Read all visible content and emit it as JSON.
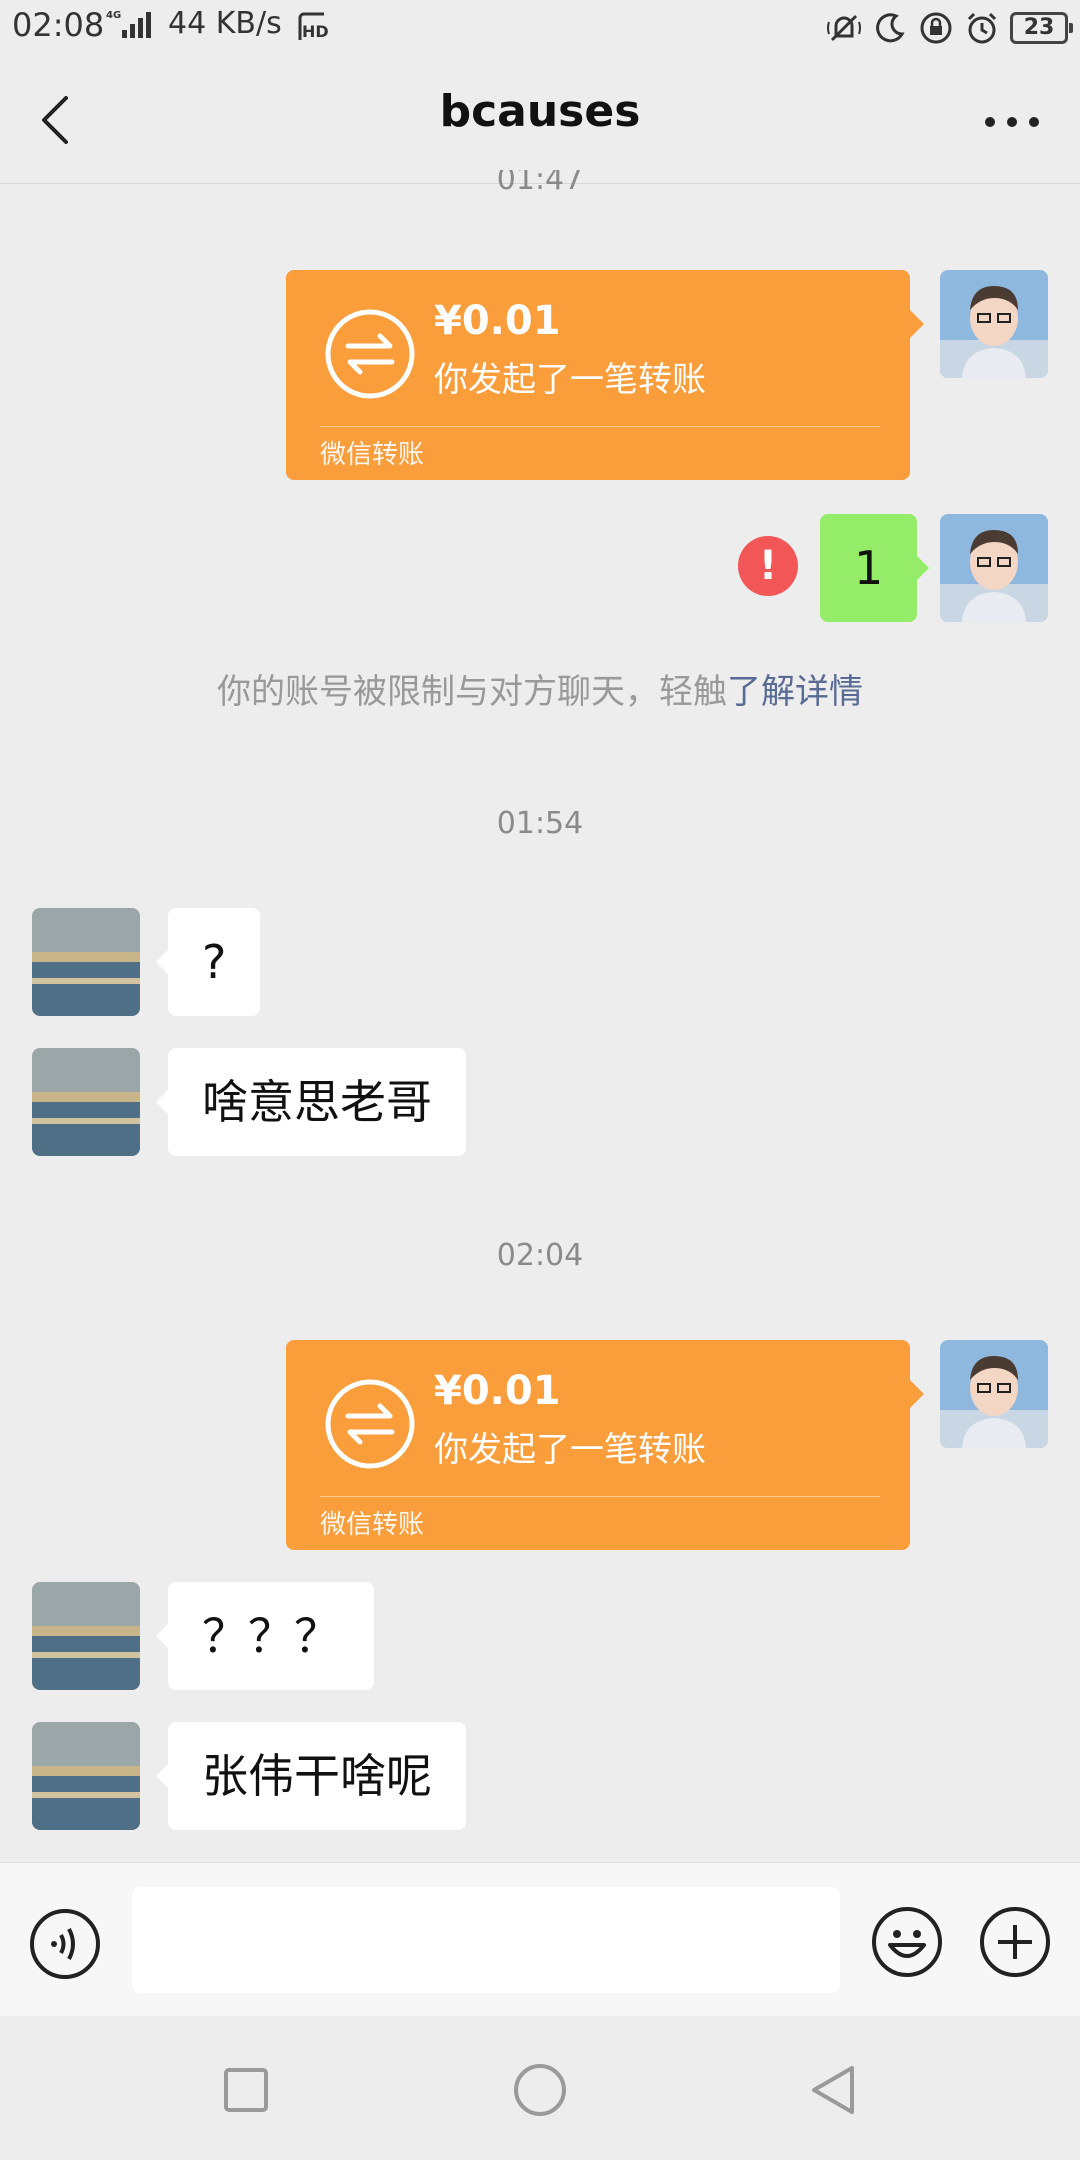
{
  "status_bar": {
    "time": "02:08",
    "network": "4G",
    "speed": "44 KB/s",
    "battery": "23"
  },
  "nav": {
    "title": "bcauses"
  },
  "chat": {
    "partial_time": "01:47",
    "transfer_1": {
      "amount": "¥0.01",
      "desc": "你发起了一笔转账",
      "footer": "微信转账"
    },
    "sent_message": "1",
    "notice": {
      "text": "你的账号被限制与对方聊天，轻触",
      "link": "了解详情"
    },
    "time_2": "01:54",
    "recv_1": "?",
    "recv_2": "啥意思老哥",
    "time_3": "02:04",
    "transfer_2": {
      "amount": "¥0.01",
      "desc": "你发起了一笔转账",
      "footer": "微信转账"
    },
    "recv_3": "？？？",
    "recv_4": "张伟干啥呢"
  },
  "input_bar": {
    "text_value": ""
  },
  "colors": {
    "transfer": "#fa9d3b",
    "sent_bubble": "#95ec69",
    "error": "#f25656",
    "link": "#576b95"
  }
}
